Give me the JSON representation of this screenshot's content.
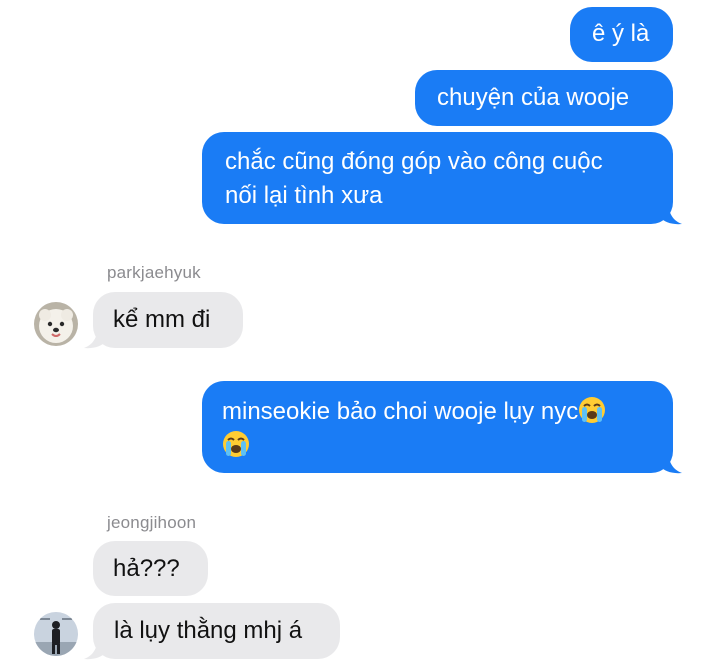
{
  "messages": [
    {
      "text": "ê ý là"
    },
    {
      "text": "chuyện của wooje"
    },
    {
      "line1": "chắc cũng đóng góp vào công cuộc",
      "line2": "nối lại tình xưa"
    },
    {
      "sender": "parkjaehyuk",
      "text": "kể mm đi"
    },
    {
      "line1": "minseokie bảo choi wooje lụy nyc"
    },
    {
      "sender": "jeongjihoon",
      "text": "hả???"
    },
    {
      "text": "là lụy thằng mhj á"
    }
  ],
  "icons": {
    "emoji": "loudly-crying-face",
    "avatar_1": "white-dog-avatar",
    "avatar_2": "person-standing-avatar"
  },
  "colors": {
    "sent_bubble": "#1a7cf5",
    "received_bubble": "#e9e9eb",
    "sender_name": "#8b8b8f"
  }
}
